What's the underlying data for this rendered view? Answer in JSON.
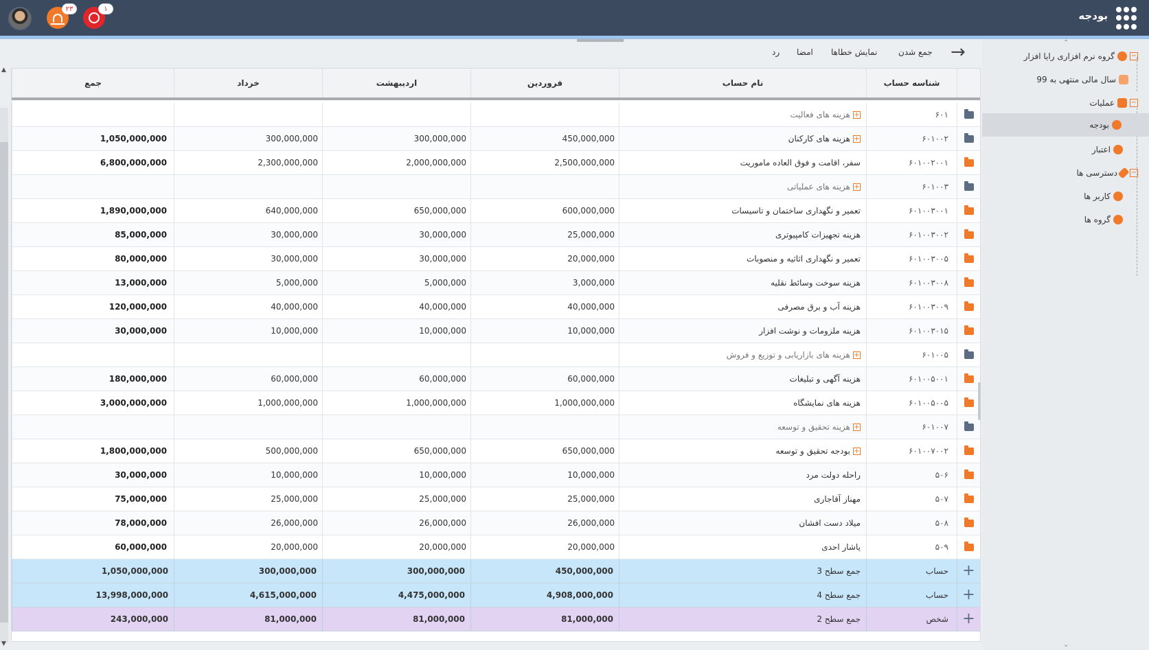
{
  "header": {
    "app_title": "بودجه",
    "notifications_count": "۲۳",
    "alerts_count": "۱"
  },
  "toolbar": {
    "collapse": "جمع شدن",
    "show_errors": "نمایش خطاها",
    "sign": "امضا",
    "reject": "رد"
  },
  "sidebar": {
    "items": [
      {
        "label": "گروه نرم افزاری رایا افزار"
      },
      {
        "label": "سال مالی منتهی به 99"
      },
      {
        "label": "عملیات"
      },
      {
        "label": "بودجه"
      },
      {
        "label": "اعتبار"
      },
      {
        "label": "دسترسی ها"
      },
      {
        "label": "کاربر ها"
      },
      {
        "label": "گروه ها"
      }
    ]
  },
  "table": {
    "columns": {
      "code": "شناسه حساب",
      "name": "نام حساب",
      "farvardin": "فروردین",
      "ordibehesht": "اردیبهشت",
      "khordad": "خرداد",
      "total": "جمع"
    },
    "rows": [
      {
        "code": "۶۰۱",
        "name": "هزینه های فعالیت",
        "group": true,
        "expand": true,
        "folder": "gray",
        "farvardin": "",
        "ordibehesht": "",
        "khordad": "",
        "total": ""
      },
      {
        "code": "۶۰۱۰۰۲",
        "name": "هزینه های کارکنان",
        "group": false,
        "expand": true,
        "folder": "gray",
        "farvardin": "450,000,000",
        "ordibehesht": "300,000,000",
        "khordad": "300,000,000",
        "total": "1,050,000,000"
      },
      {
        "code": "۶۰۱۰۰۲۰۰۱",
        "name": "سفر، اقامت و فوق العاده ماموریت",
        "group": false,
        "expand": false,
        "folder": "orange",
        "farvardin": "2,500,000,000",
        "ordibehesht": "2,000,000,000",
        "khordad": "2,300,000,000",
        "total": "6,800,000,000"
      },
      {
        "code": "۶۰۱۰۰۳",
        "name": "هزینه های عملیاتی",
        "group": true,
        "expand": true,
        "folder": "gray",
        "farvardin": "",
        "ordibehesht": "",
        "khordad": "",
        "total": ""
      },
      {
        "code": "۶۰۱۰۰۳۰۰۱",
        "name": "تعمیر و نگهداری ساختمان و تاسیسات",
        "group": false,
        "expand": false,
        "folder": "orange",
        "farvardin": "600,000,000",
        "ordibehesht": "650,000,000",
        "khordad": "640,000,000",
        "total": "1,890,000,000"
      },
      {
        "code": "۶۰۱۰۰۳۰۰۲",
        "name": "هزینه تجهیزات کامپیوتری",
        "group": false,
        "expand": false,
        "folder": "orange",
        "farvardin": "25,000,000",
        "ordibehesht": "30,000,000",
        "khordad": "30,000,000",
        "total": "85,000,000"
      },
      {
        "code": "۶۰۱۰۰۳۰۰۵",
        "name": "تعمیر و نگهداری اثاثیه و منصوبات",
        "group": false,
        "expand": false,
        "folder": "orange",
        "farvardin": "20,000,000",
        "ordibehesht": "30,000,000",
        "khordad": "30,000,000",
        "total": "80,000,000"
      },
      {
        "code": "۶۰۱۰۰۳۰۰۸",
        "name": "هزینه سوخت وسائط نقلیه",
        "group": false,
        "expand": false,
        "folder": "orange",
        "farvardin": "3,000,000",
        "ordibehesht": "5,000,000",
        "khordad": "5,000,000",
        "total": "13,000,000"
      },
      {
        "code": "۶۰۱۰۰۳۰۰۹",
        "name": "هزینه آب و برق مصرفی",
        "group": false,
        "expand": false,
        "folder": "orange",
        "farvardin": "40,000,000",
        "ordibehesht": "40,000,000",
        "khordad": "40,000,000",
        "total": "120,000,000"
      },
      {
        "code": "۶۰۱۰۰۳۰۱۵",
        "name": "هزینه ملزومات و نوشت افزار",
        "group": false,
        "expand": false,
        "folder": "orange",
        "farvardin": "10,000,000",
        "ordibehesht": "10,000,000",
        "khordad": "10,000,000",
        "total": "30,000,000"
      },
      {
        "code": "۶۰۱۰۰۵",
        "name": "هزینه های بازاریابی و توزیع و فروش",
        "group": true,
        "expand": true,
        "folder": "gray",
        "farvardin": "",
        "ordibehesht": "",
        "khordad": "",
        "total": ""
      },
      {
        "code": "۶۰۱۰۰۵۰۰۱",
        "name": "هزینه آگهی و تبلیغات",
        "group": false,
        "expand": false,
        "folder": "orange",
        "farvardin": "60,000,000",
        "ordibehesht": "60,000,000",
        "khordad": "60,000,000",
        "total": "180,000,000"
      },
      {
        "code": "۶۰۱۰۰۵۰۰۵",
        "name": "هزینه های نمایشگاه",
        "group": false,
        "expand": false,
        "folder": "orange",
        "farvardin": "1,000,000,000",
        "ordibehesht": "1,000,000,000",
        "khordad": "1,000,000,000",
        "total": "3,000,000,000"
      },
      {
        "code": "۶۰۱۰۰۷",
        "name": "هزینه تحقیق و توسعه",
        "group": true,
        "expand": true,
        "folder": "gray",
        "farvardin": "",
        "ordibehesht": "",
        "khordad": "",
        "total": ""
      },
      {
        "code": "۶۰۱۰۰۷۰۰۲",
        "name": "بودجه تحقیق و توسعه",
        "group": false,
        "expand": true,
        "folder": "orange",
        "farvardin": "650,000,000",
        "ordibehesht": "650,000,000",
        "khordad": "500,000,000",
        "total": "1,800,000,000"
      },
      {
        "code": "۵۰۶",
        "name": "راحله دولت مرد",
        "group": false,
        "expand": false,
        "folder": "orange",
        "farvardin": "10,000,000",
        "ordibehesht": "10,000,000",
        "khordad": "10,000,000",
        "total": "30,000,000"
      },
      {
        "code": "۵۰۷",
        "name": "مهناز آقاجاری",
        "group": false,
        "expand": false,
        "folder": "orange",
        "farvardin": "25,000,000",
        "ordibehesht": "25,000,000",
        "khordad": "25,000,000",
        "total": "75,000,000"
      },
      {
        "code": "۵۰۸",
        "name": "میلاد دست افشان",
        "group": false,
        "expand": false,
        "folder": "orange",
        "farvardin": "26,000,000",
        "ordibehesht": "26,000,000",
        "khordad": "26,000,000",
        "total": "78,000,000"
      },
      {
        "code": "۵۰۹",
        "name": "یاشار احدی",
        "group": false,
        "expand": false,
        "folder": "orange",
        "farvardin": "20,000,000",
        "ordibehesht": "20,000,000",
        "khordad": "20,000,000",
        "total": "60,000,000"
      }
    ],
    "summary_rows": [
      {
        "type": "حساب",
        "label": "جمع سطح 3",
        "color": "blue",
        "farvardin": "450,000,000",
        "ordibehesht": "300,000,000",
        "khordad": "300,000,000",
        "total": "1,050,000,000"
      },
      {
        "type": "حساب",
        "label": "جمع سطح 4",
        "color": "blue",
        "farvardin": "4,908,000,000",
        "ordibehesht": "4,475,000,000",
        "khordad": "4,615,000,000",
        "total": "13,998,000,000"
      },
      {
        "type": "شخص",
        "label": "جمع سطح 2",
        "color": "purple",
        "farvardin": "81,000,000",
        "ordibehesht": "81,000,000",
        "khordad": "81,000,000",
        "total": "243,000,000"
      }
    ]
  }
}
